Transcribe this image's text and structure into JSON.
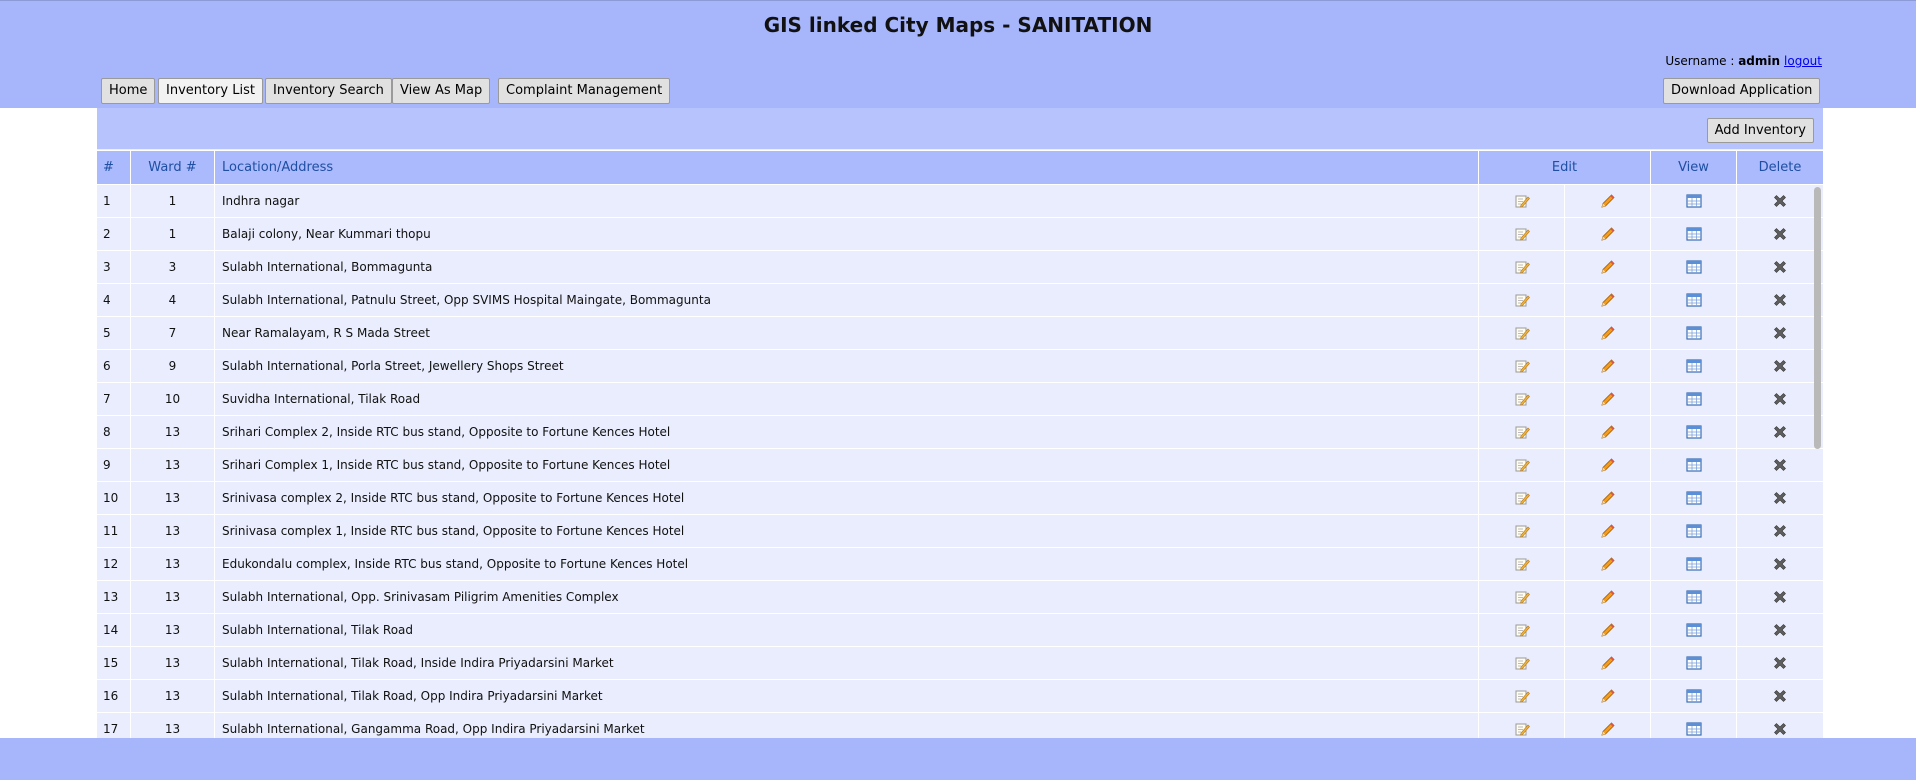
{
  "header": {
    "title": "GIS linked City Maps - SANITATION",
    "username_label": "Username : ",
    "username": "admin",
    "logout_label": "logout"
  },
  "nav": {
    "home": "Home",
    "inventory_list": "Inventory List",
    "inventory_search": "Inventory Search",
    "view_as_map": "View As Map",
    "complaint_management": "Complaint Management",
    "download_application": "Download Application"
  },
  "panel": {
    "add_inventory": "Add Inventory"
  },
  "table": {
    "columns": {
      "num": "#",
      "ward": "Ward #",
      "location": "Location/Address",
      "edit": "Edit",
      "view": "View",
      "delete": "Delete"
    },
    "rows": [
      {
        "num": "1",
        "ward": "1",
        "location": "Indhra nagar"
      },
      {
        "num": "2",
        "ward": "1",
        "location": "Balaji colony, Near Kummari thopu"
      },
      {
        "num": "3",
        "ward": "3",
        "location": "Sulabh International, Bommagunta"
      },
      {
        "num": "4",
        "ward": "4",
        "location": "Sulabh International, Patnulu Street, Opp SVIMS Hospital Maingate, Bommagunta"
      },
      {
        "num": "5",
        "ward": "7",
        "location": "Near Ramalayam, R S Mada Street"
      },
      {
        "num": "6",
        "ward": "9",
        "location": "Sulabh International, Porla Street, Jewellery Shops Street"
      },
      {
        "num": "7",
        "ward": "10",
        "location": "Suvidha International, Tilak Road"
      },
      {
        "num": "8",
        "ward": "13",
        "location": "Srihari Complex 2, Inside RTC bus stand, Opposite to Fortune Kences Hotel"
      },
      {
        "num": "9",
        "ward": "13",
        "location": "Srihari Complex 1, Inside RTC bus stand, Opposite to Fortune Kences Hotel"
      },
      {
        "num": "10",
        "ward": "13",
        "location": "Srinivasa complex 2, Inside RTC bus stand, Opposite to Fortune Kences Hotel"
      },
      {
        "num": "11",
        "ward": "13",
        "location": "Srinivasa complex 1, Inside RTC bus stand, Opposite to Fortune Kences Hotel"
      },
      {
        "num": "12",
        "ward": "13",
        "location": "Edukondalu complex, Inside RTC bus stand, Opposite to Fortune Kences Hotel"
      },
      {
        "num": "13",
        "ward": "13",
        "location": "Sulabh International, Opp. Srinivasam Piligrim Amenities Complex"
      },
      {
        "num": "14",
        "ward": "13",
        "location": "Sulabh International, Tilak Road"
      },
      {
        "num": "15",
        "ward": "13",
        "location": "Sulabh International, Tilak Road, Inside Indira Priyadarsini Market"
      },
      {
        "num": "16",
        "ward": "13",
        "location": "Sulabh International, Tilak Road, Opp Indira Priyadarsini Market"
      },
      {
        "num": "17",
        "ward": "13",
        "location": "Sulabh International, Gangamma Road, Opp Indira Priyadarsini Market"
      }
    ]
  },
  "icons": {
    "edit_details": "edit-details-icon",
    "edit_pencil": "pencil-icon",
    "view": "table-view-icon",
    "delete": "delete-icon"
  },
  "colors": {
    "header_bg": "#a7b6fb",
    "panel_bg": "#e9edfd",
    "table_header_bg": "#abbafc",
    "header_text": "#1f4fa3"
  }
}
